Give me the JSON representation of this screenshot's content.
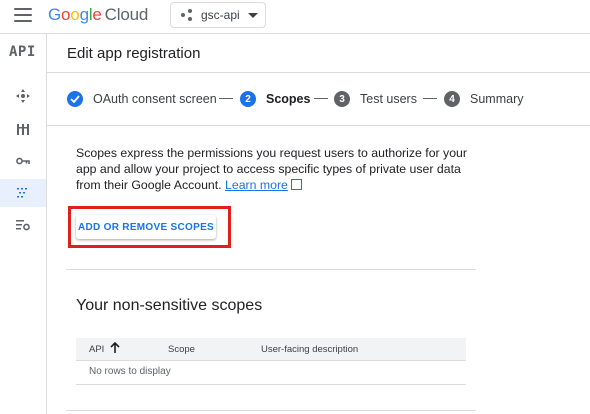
{
  "topbar": {
    "logo_google": [
      "G",
      "o",
      "o",
      "g",
      "l",
      "e"
    ],
    "logo_cloud": "Cloud",
    "project_name": "gsc-api"
  },
  "rail": {
    "api_label": "API",
    "icons": [
      "apis-icon",
      "library-icon",
      "credentials-key-icon",
      "oauth-consent-icon",
      "settings-icon"
    ]
  },
  "header": {
    "title": "Edit app registration"
  },
  "stepper": {
    "steps": [
      {
        "number": "1",
        "label": "OAuth consent screen",
        "state": "done"
      },
      {
        "number": "2",
        "label": "Scopes",
        "state": "current"
      },
      {
        "number": "3",
        "label": "Test users",
        "state": "todo"
      },
      {
        "number": "4",
        "label": "Summary",
        "state": "todo"
      }
    ]
  },
  "main": {
    "description": "Scopes express the permissions you request users to authorize for your app and allow your project to access specific types of private user data from their Google Account.",
    "learn_more": "Learn more",
    "add_remove_button": "ADD OR REMOVE SCOPES",
    "section_title": "Your non-sensitive scopes",
    "table": {
      "columns": [
        "API",
        "Scope",
        "User-facing description"
      ],
      "empty_text": "No rows to display"
    }
  },
  "colors": {
    "accent": "#1a73e8",
    "highlight": "#e0201c"
  }
}
